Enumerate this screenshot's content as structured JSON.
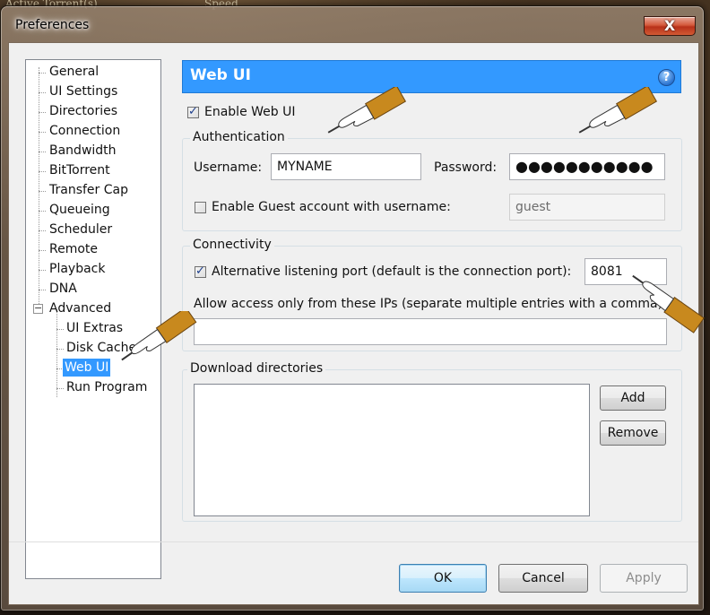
{
  "background": {
    "top_left_text": "Active Torrent(s)",
    "top_mid_text": "Speed"
  },
  "window": {
    "title": "Preferences",
    "close_label": "X"
  },
  "tree": {
    "items": [
      "General",
      "UI Settings",
      "Directories",
      "Connection",
      "Bandwidth",
      "BitTorrent",
      "Transfer Cap",
      "Queueing",
      "Scheduler",
      "Remote",
      "Playback",
      "DNA",
      "Advanced"
    ],
    "advanced_expander": "−",
    "children": [
      "UI Extras",
      "Disk Cache",
      "Web UI",
      "Run Program"
    ],
    "selected": "Web UI"
  },
  "header": {
    "title": "Web UI",
    "help": "?"
  },
  "enable_webui": {
    "label": "Enable Web UI",
    "checked": true
  },
  "authentication": {
    "title": "Authentication",
    "username_label": "Username:",
    "username_value": "MYNAME",
    "password_label": "Password:",
    "password_value": "●●●●●●●●●●●",
    "guest_label": "Enable Guest account with username:",
    "guest_checked": false,
    "guest_value": "guest"
  },
  "connectivity": {
    "title": "Connectivity",
    "alt_port_label": "Alternative listening port (default is the connection port):",
    "alt_port_checked": true,
    "alt_port_value": "8081",
    "ip_label": "Allow access only from these IPs (separate multiple entries with a comma):",
    "ip_value": ""
  },
  "download_dirs": {
    "title": "Download directories",
    "add": "Add",
    "remove": "Remove"
  },
  "footer": {
    "ok": "OK",
    "cancel": "Cancel",
    "apply": "Apply"
  },
  "colors": {
    "accent": "#3399ff",
    "pointer": "#c8891e"
  }
}
